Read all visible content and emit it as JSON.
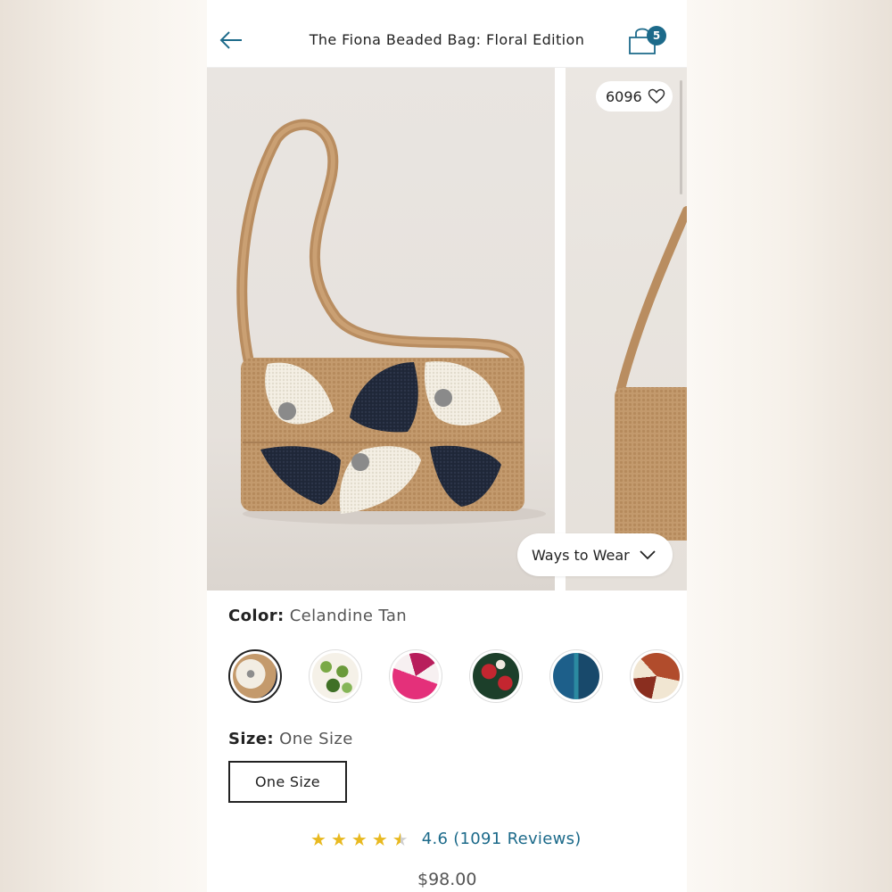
{
  "header": {
    "title": "The Fiona Beaded Bag: Floral Edition",
    "bag_count": "5"
  },
  "gallery": {
    "likes": "6096",
    "ways_to_wear_label": "Ways to Wear"
  },
  "color": {
    "label": "Color:",
    "selected": "Celandine Tan",
    "swatches": [
      {
        "name": "celandine-tan",
        "colors": [
          "#c49a6c",
          "#f2ede3",
          "#1f2636"
        ]
      },
      {
        "name": "green",
        "colors": [
          "#f5f1e8",
          "#6a9a3a",
          "#3f7026"
        ]
      },
      {
        "name": "pink",
        "colors": [
          "#f7f0f1",
          "#e4307a",
          "#b81e5c"
        ]
      },
      {
        "name": "red",
        "colors": [
          "#1c3f2a",
          "#c42630",
          "#f1e9e0"
        ]
      },
      {
        "name": "blue-teal",
        "colors": [
          "#1d5f8a",
          "#2b8aa1",
          "#18496b"
        ]
      },
      {
        "name": "rust",
        "colors": [
          "#f1e6d2",
          "#b14c2c",
          "#8a2e1f"
        ]
      }
    ]
  },
  "size": {
    "label": "Size:",
    "selected": "One Size",
    "button_label": "One Size"
  },
  "rating": {
    "stars": 4.5,
    "text": "4.6 (1091 Reviews)"
  },
  "price": "$98.00",
  "colors": {
    "accent": "#1c6a8a",
    "star": "#e8b920",
    "text": "#222222"
  }
}
